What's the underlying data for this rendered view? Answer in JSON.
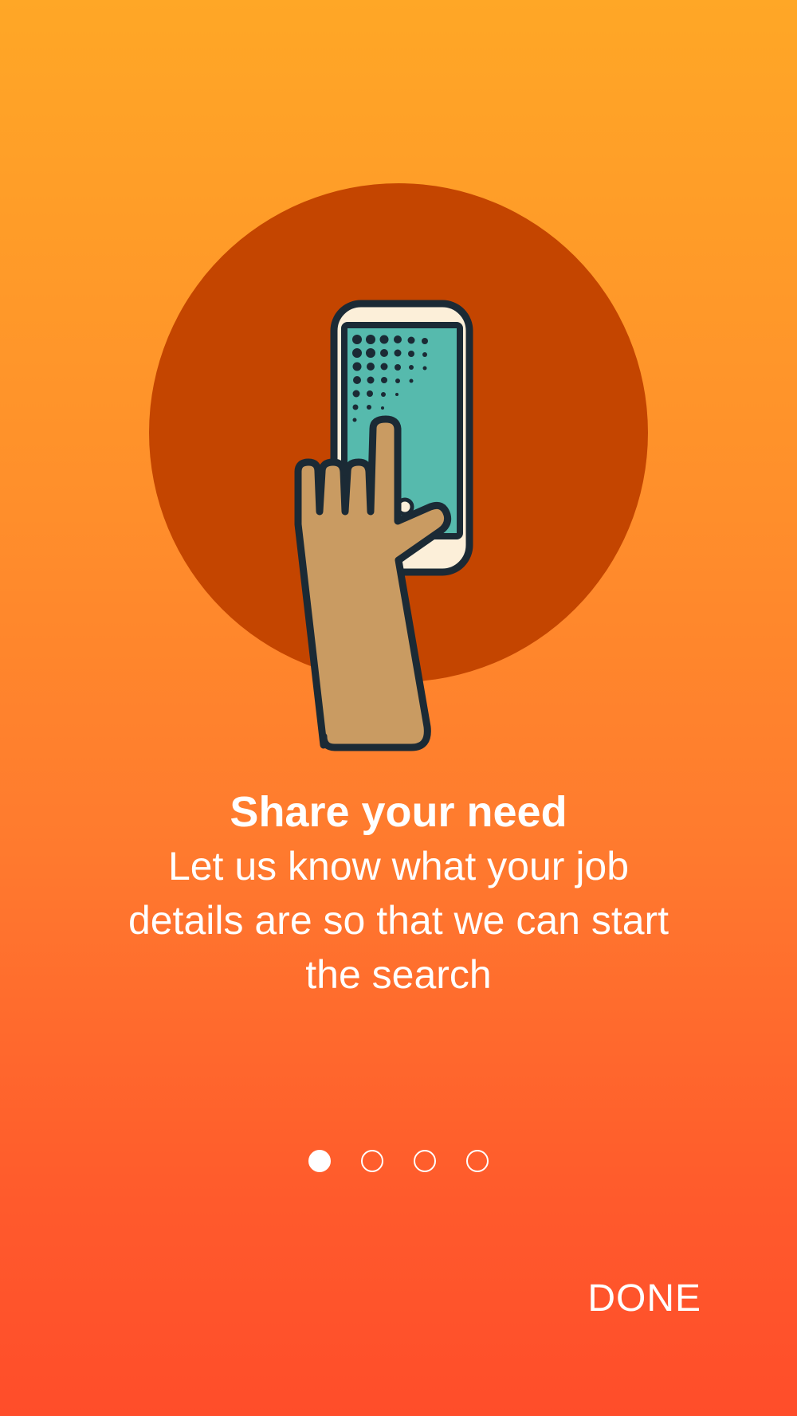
{
  "colors": {
    "gradient_top": "#FFA726",
    "gradient_bottom": "#FF4D2A",
    "circle": "#C44500",
    "phone_screen": "#56BAAD",
    "hand": "#C99B62",
    "outline": "#1B2A35",
    "phone_body": "#FCEFD9"
  },
  "illustration": {
    "icon": "hand-tapping-phone-icon"
  },
  "onboarding": {
    "title": "Share your need",
    "description": "Let us know what your job details are so that we can start the search"
  },
  "pager": {
    "total_pages": 4,
    "current_page": 1
  },
  "actions": {
    "done_label": "DONE"
  }
}
